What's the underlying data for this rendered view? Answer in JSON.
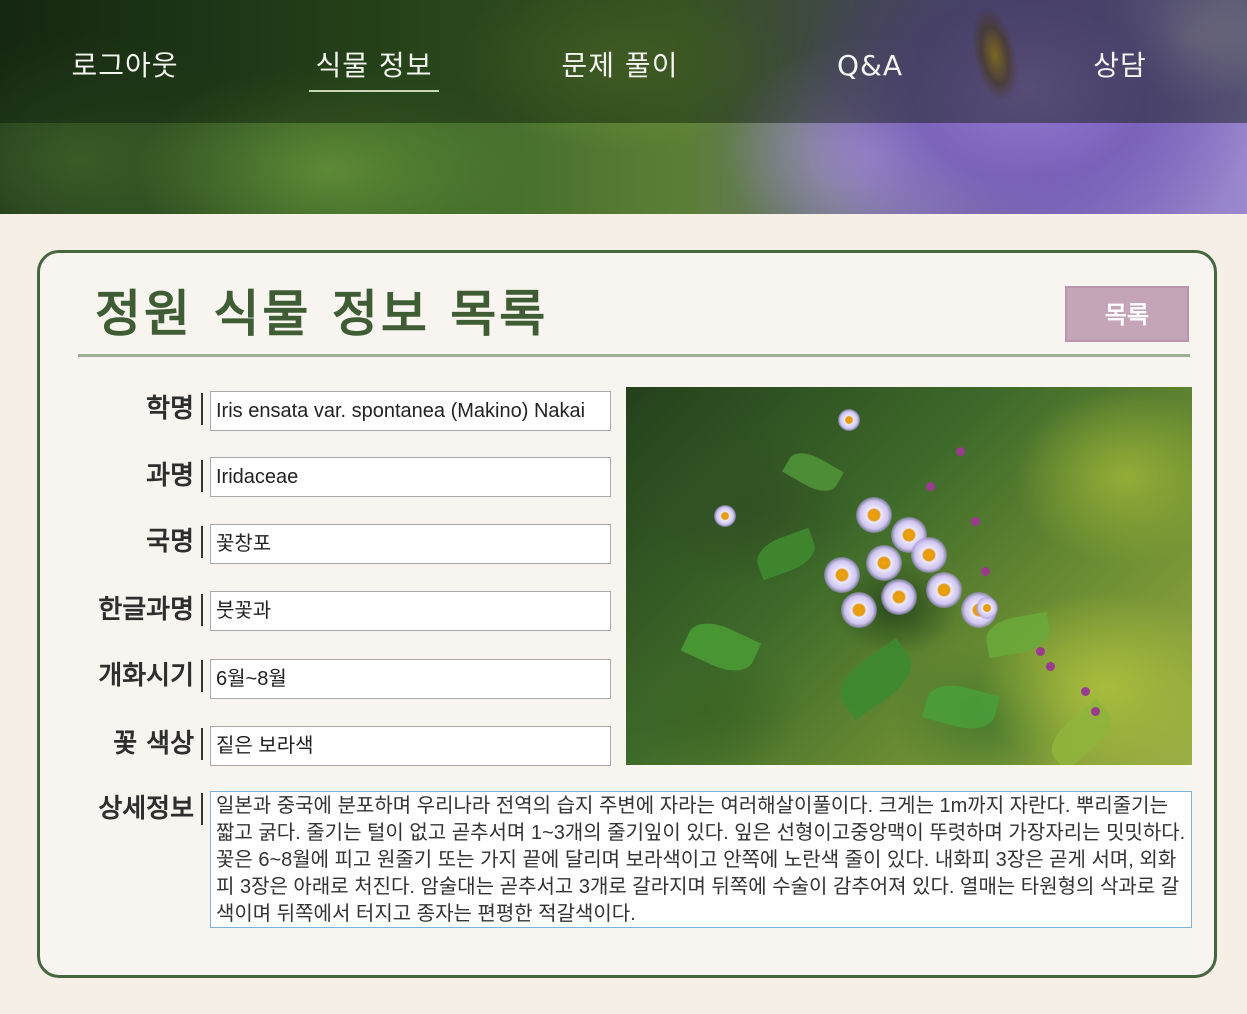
{
  "nav": {
    "logout": "로그아웃",
    "plant_info": "식물 정보",
    "quiz": "문제 풀이",
    "qa": "Q&A",
    "consult": "상담",
    "active": "plant_info"
  },
  "page": {
    "title": "정원 식물 정보 목록",
    "list_button": "목록"
  },
  "fields": {
    "scientific_name": {
      "label": "학명",
      "value": "Iris ensata var. spontanea (Makino) Nakai"
    },
    "family": {
      "label": "과명",
      "value": "Iridaceae"
    },
    "korean_name": {
      "label": "국명",
      "value": "꽃창포"
    },
    "korean_family": {
      "label": "한글과명",
      "value": "붓꽃과"
    },
    "bloom_period": {
      "label": "개화시기",
      "value": "6월~8월"
    },
    "flower_color": {
      "label": "꽃 색상",
      "value": "짙은 보라색"
    },
    "detail": {
      "label": "상세정보",
      "value": "일본과 중국에 분포하며 우리나라 전역의 습지 주변에 자라는 여러해살이풀이다. 크게는 1m까지 자란다. 뿌리줄기는 짧고 굵다. 줄기는 털이 없고 곧추서며 1~3개의 줄기잎이 있다. 잎은 선형이고중앙맥이 뚜렷하며 가장자리는 밋밋하다. 꽃은 6~8월에 피고 원줄기 또는 가지 끝에 달리며 보라색이고 안쪽에 노란색 줄이 있다. 내화피 3장은 곧게 서며, 외화피 3장은 아래로 처진다. 암술대는 곧추서고 3개로 갈라지며 뒤쪽에 수술이 감추어져 있다. 열매는 타원형의 삭과로 갈색이며 뒤쪽에서 터지고 종자는 편평한 적갈색이다."
    }
  },
  "colors": {
    "accent_green": "#3f5d34",
    "card_border": "#46663f",
    "list_button_bg": "#c4a4b7",
    "page_bg": "#f6efe6"
  }
}
